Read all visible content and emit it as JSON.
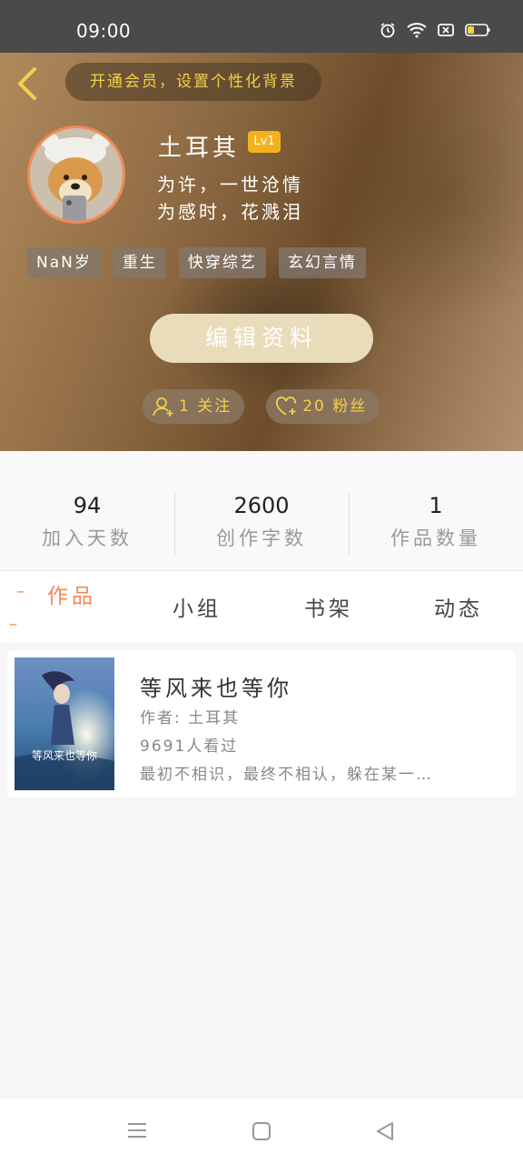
{
  "status": {
    "time": "09:00"
  },
  "header": {
    "member_prompt": "开通会员，设置个性化背景"
  },
  "profile": {
    "name": "土耳其",
    "level": "Lv1",
    "bio_line1": "为许，一世沧情",
    "bio_line2": "为感时，花溅泪",
    "tags": [
      "NaN岁",
      "重生",
      "快穿综艺",
      "玄幻言情"
    ],
    "edit_label": "编辑资料",
    "following": "1 关注",
    "followers": "20 粉丝"
  },
  "stats": [
    {
      "value": "94",
      "label": "加入天数"
    },
    {
      "value": "2600",
      "label": "创作字数"
    },
    {
      "value": "1",
      "label": "作品数量"
    }
  ],
  "tabs": [
    "作品",
    "小组",
    "书架",
    "动态"
  ],
  "works": [
    {
      "title": "等风来也等你",
      "author": "作者: 土耳其",
      "views": "9691人看过",
      "summary": "最初不相识，最终不相认，躲在某一…",
      "cover_text": "等风来也等你"
    }
  ],
  "colors": {
    "accent": "#f08a55",
    "gold": "#f3d14a",
    "badge": "#f2b21d"
  }
}
